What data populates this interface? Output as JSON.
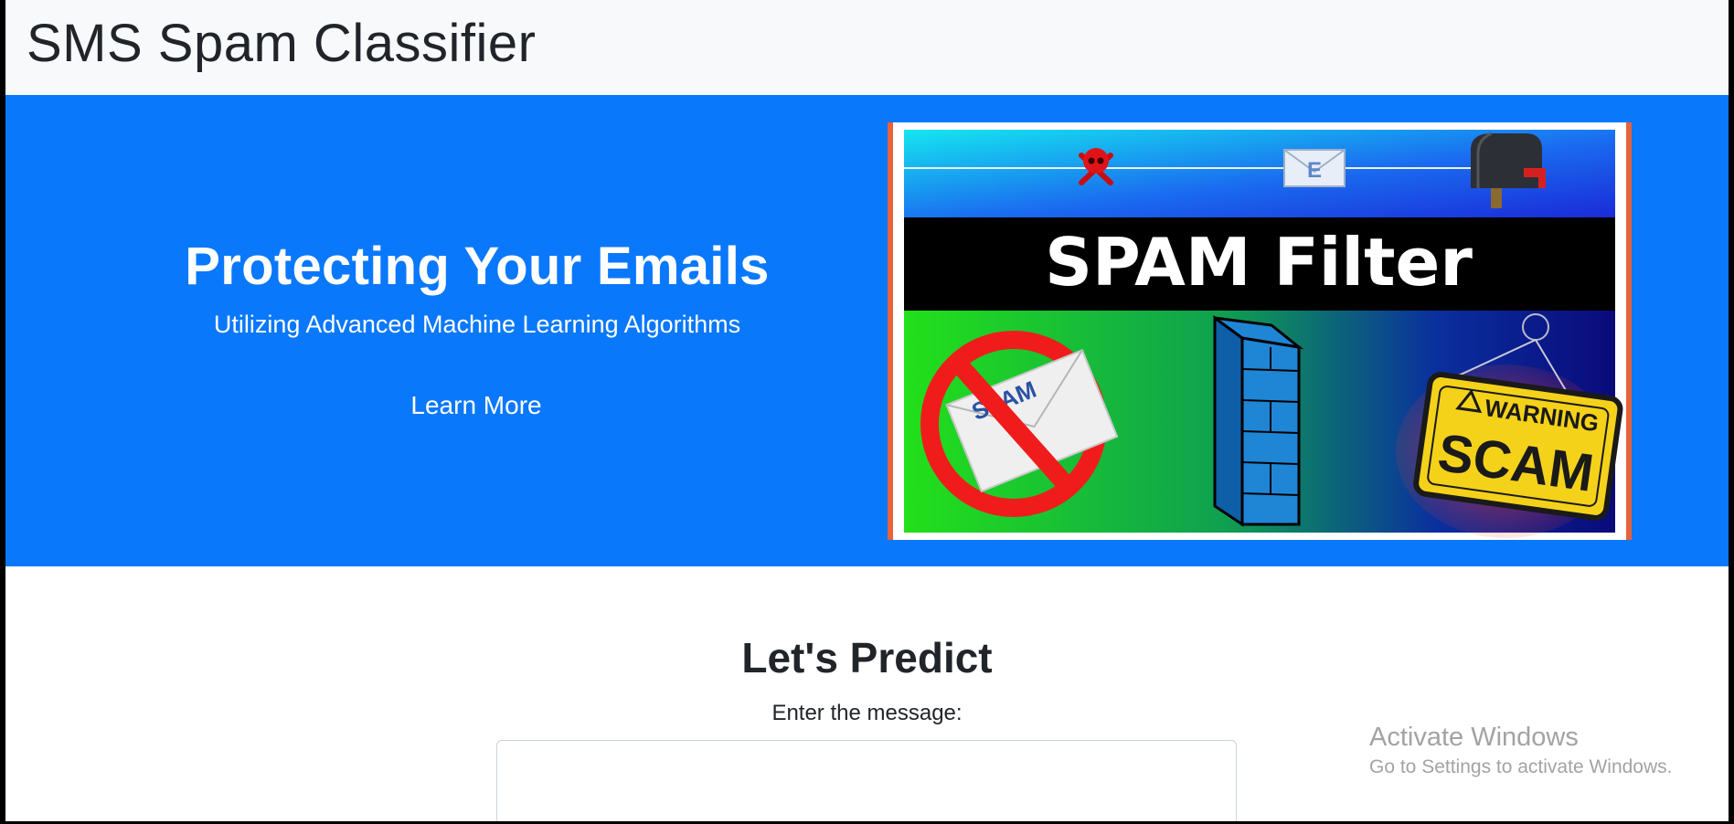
{
  "navbar": {
    "brand": "SMS Spam Classifier"
  },
  "hero": {
    "title": "Protecting Your Emails",
    "subtitle": "Utilizing Advanced Machine Learning Algorithms",
    "cta_label": "Learn More",
    "background_color": "#0a78fb",
    "image": {
      "headline": "SPAM Filter",
      "envelope_label": "E",
      "spam_label": "SPAM",
      "warning_label": "WARNING",
      "scam_label": "SCAM"
    }
  },
  "predict": {
    "title": "Let's Predict",
    "label": "Enter the message:",
    "input_value": ""
  },
  "watermark": {
    "title": "Activate Windows",
    "subtitle": "Go to Settings to activate Windows."
  }
}
